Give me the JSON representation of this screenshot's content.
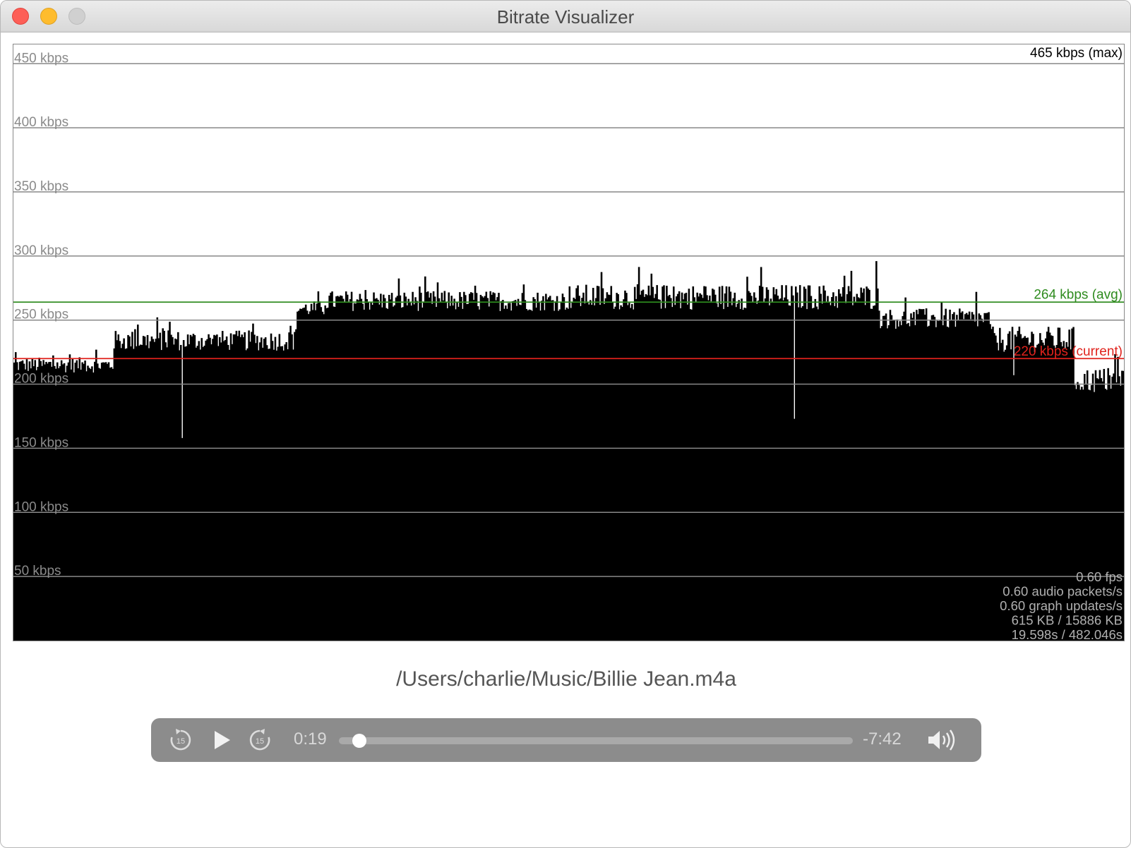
{
  "window": {
    "title": "Bitrate Visualizer"
  },
  "chart_data": {
    "type": "bar",
    "title": "",
    "ylabel": "",
    "ylim": [
      0,
      465
    ],
    "y_unit": "kbps",
    "y_gridlines": [
      50,
      100,
      150,
      200,
      250,
      300,
      350,
      400,
      450
    ],
    "y_tick_labels": [
      "50 kbps",
      "100 kbps",
      "150 kbps",
      "200 kbps",
      "250 kbps",
      "300 kbps",
      "350 kbps",
      "400 kbps",
      "450 kbps"
    ],
    "max_kbps": 465,
    "max_label": "465 kbps (max)",
    "avg_kbps": 264,
    "avg_label": "264 kbps (avg)",
    "current_kbps": 220,
    "current_label": "220 kbps (current)",
    "bar_count": 800,
    "segments": [
      {
        "from": 0.0,
        "to": 0.09,
        "base": 215,
        "jitter": 6
      },
      {
        "from": 0.09,
        "to": 0.255,
        "base": 234,
        "jitter": 8
      },
      {
        "from": 0.255,
        "to": 0.28,
        "base": 259,
        "jitter": 6
      },
      {
        "from": 0.28,
        "to": 0.5,
        "base": 265,
        "jitter": 8
      },
      {
        "from": 0.5,
        "to": 0.778,
        "base": 268,
        "jitter": 10
      },
      {
        "from": 0.778,
        "to": 0.88,
        "base": 251,
        "jitter": 8
      },
      {
        "from": 0.88,
        "to": 0.955,
        "base": 235,
        "jitter": 10
      },
      {
        "from": 0.955,
        "to": 1.0,
        "base": 203,
        "jitter": 10
      }
    ],
    "spikes": [
      {
        "at": 0.152,
        "value": 158
      },
      {
        "at": 0.703,
        "value": 173
      },
      {
        "at": 0.777,
        "value": 296
      },
      {
        "at": 0.9,
        "value": 207
      },
      {
        "at": 0.867,
        "value": 272
      }
    ],
    "stats": [
      "0.60 fps",
      "0.60 audio packets/s",
      "0.60 graph updates/s",
      "615 KB / 15886 KB",
      "19.598s / 482.046s"
    ],
    "colors": {
      "bars": "#000000",
      "grid": "#888888",
      "avg_line": "#2e8b1e",
      "current_line": "#e0221c",
      "stats_text": "#b0b0b0",
      "tick_text": "#8a8a8a"
    }
  },
  "file": {
    "path": "/Users/charlie/Music/Billie Jean.m4a"
  },
  "player": {
    "rewind_icon": "skip-back-15-icon",
    "rewind_label": "15",
    "play_icon": "play-icon",
    "forward_icon": "skip-forward-15-icon",
    "forward_label": "15",
    "elapsed": "0:19",
    "remaining": "-7:42",
    "progress_fraction": 0.04,
    "volume_icon": "volume-icon"
  }
}
